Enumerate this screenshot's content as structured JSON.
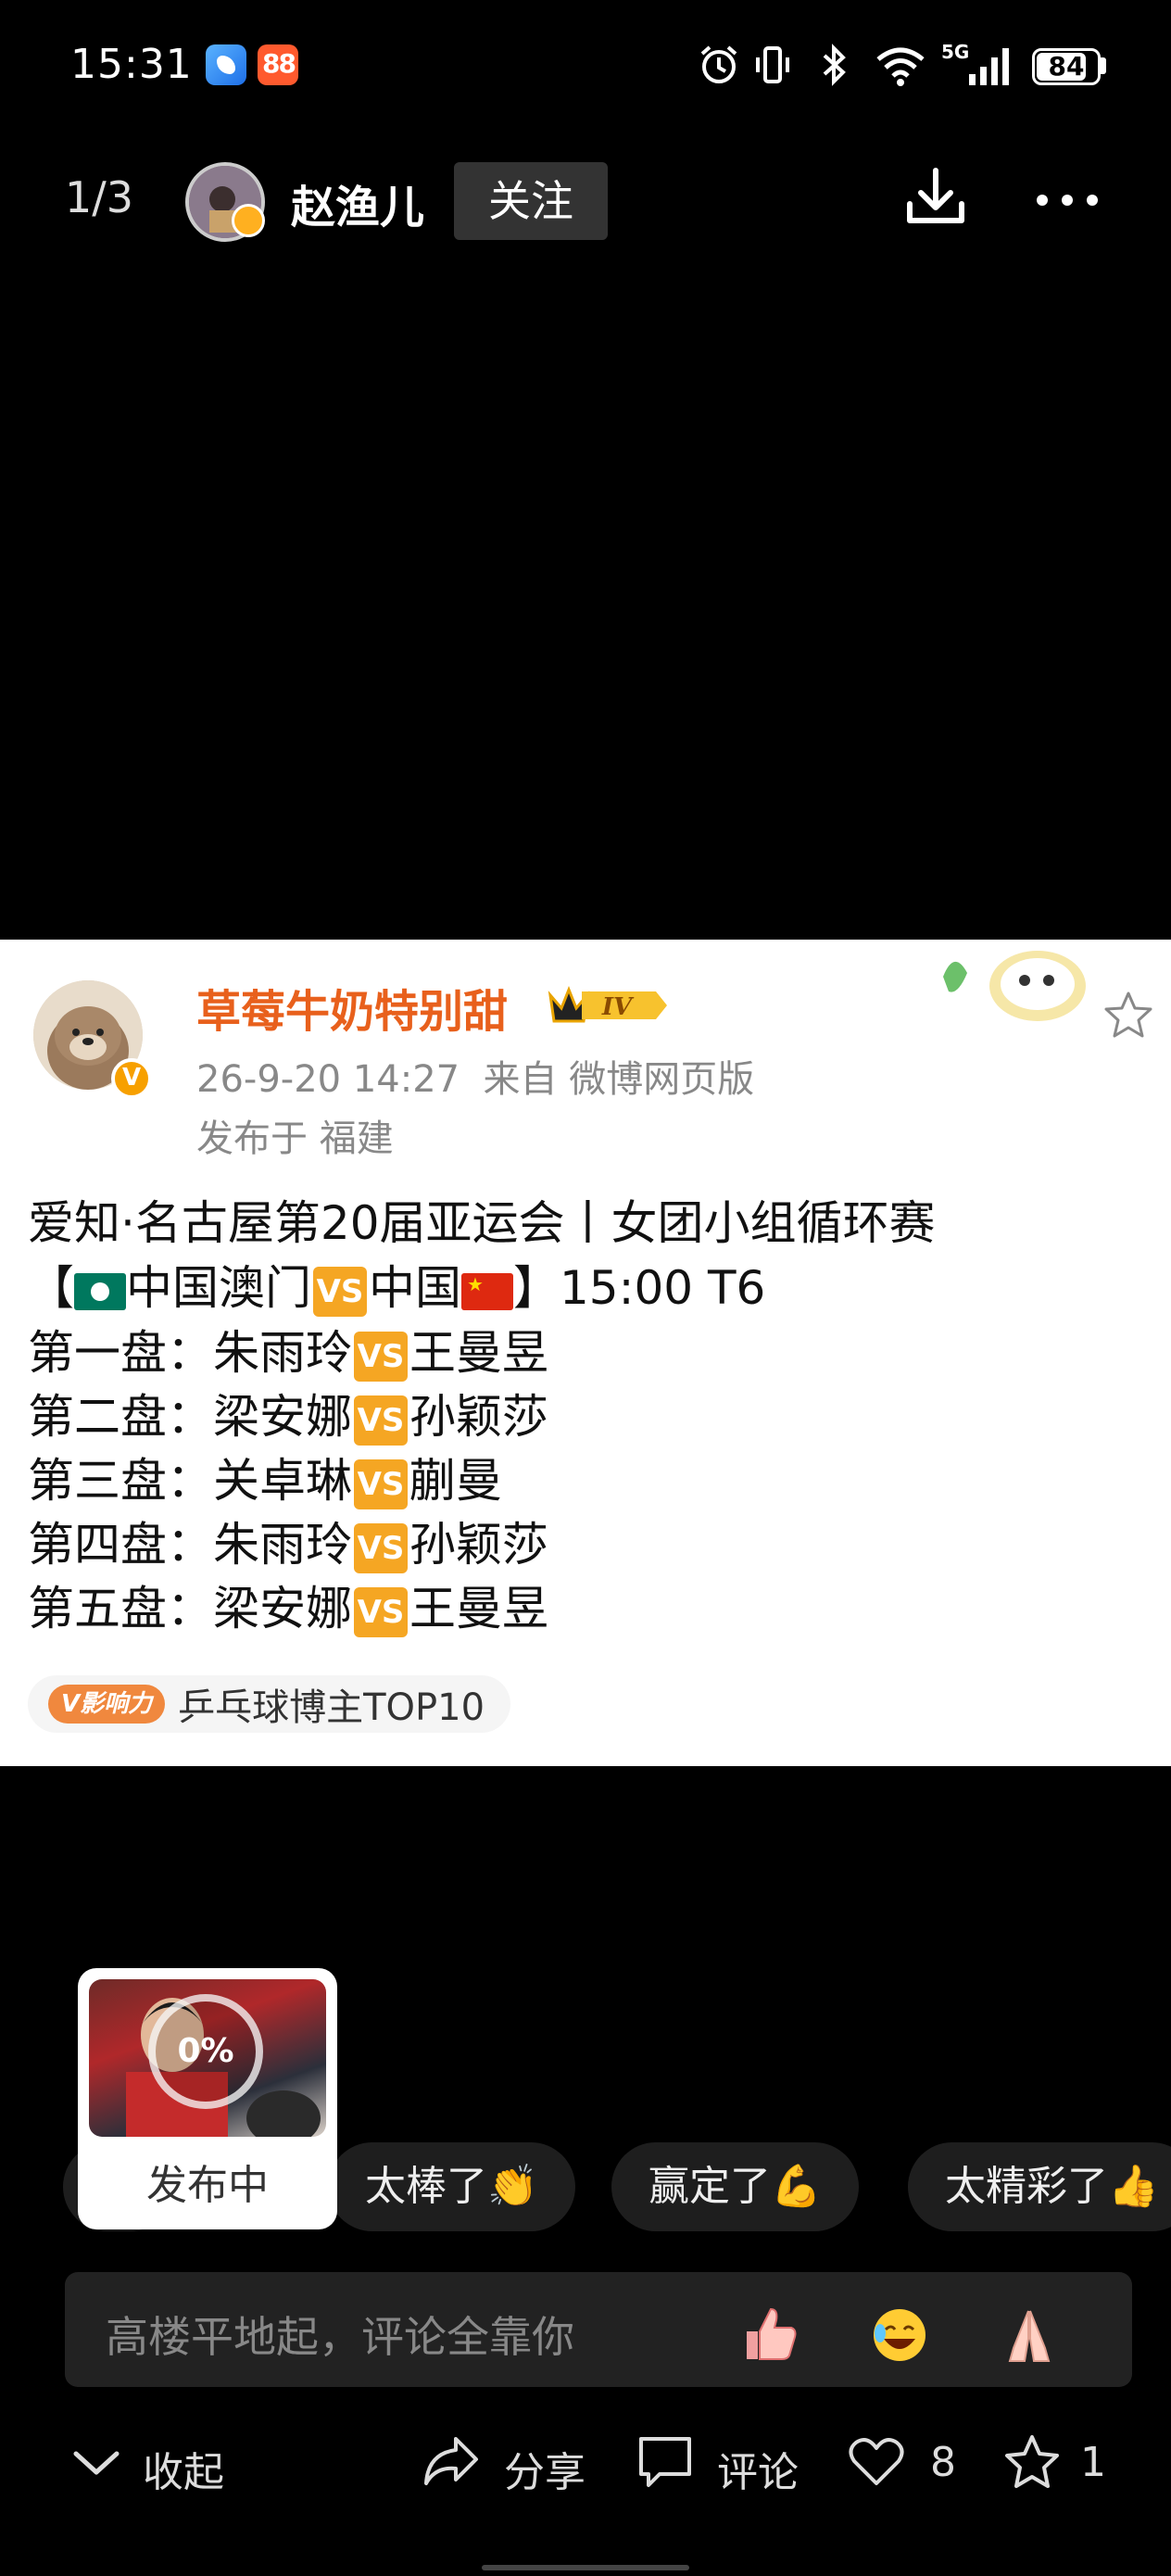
{
  "status_bar": {
    "time": "15:31",
    "network": "5G",
    "battery": "84",
    "battery_level": 0.84
  },
  "header": {
    "pager": "1/3",
    "username": "赵渔儿",
    "follow_label": "关注"
  },
  "post": {
    "author": "草莓牛奶特别甜",
    "level_badge": "IV",
    "time": "26-9-20 14:27",
    "source": "来自 微博网页版",
    "location": "发布于 福建",
    "vs_label": "VS",
    "lines": {
      "title": "爱知·名古屋第20届亚运会丨女团小组循环赛",
      "match_open": "【",
      "match_team1": "中国澳门",
      "match_team2": "中国",
      "match_close": "】15:00 T6",
      "g1_label": "第一盘：",
      "g1_p1": "朱雨玲",
      "g1_p2": "王曼昱",
      "g2_label": "第二盘：",
      "g2_p1": "梁安娜",
      "g2_p2": "孙颖莎",
      "g3_label": "第三盘：",
      "g3_p1": "关卓琳",
      "g3_p2": "蒯曼",
      "g4_label": "第四盘：",
      "g4_p1": "朱雨玲",
      "g4_p2": "孙颖莎",
      "g5_label": "第五盘：",
      "g5_p1": "梁安娜",
      "g5_p2": "王曼昱"
    },
    "influence_badge": "V影响力",
    "influence_text": "乒乓球博主TOP10"
  },
  "publishing": {
    "percent": "0%",
    "progress": 0,
    "label": "发布中"
  },
  "quick_replies": [
    "太棒了👏",
    "赢定了💪",
    "太精彩了👍"
  ],
  "comment": {
    "placeholder": "高楼平地起，评论全靠你"
  },
  "bottom_bar": {
    "collapse_label": "收起",
    "share_label": "分享",
    "comment_label": "评论",
    "like_count": "8",
    "favorite_count": "1"
  },
  "colors": {
    "accent": "#e8601c",
    "vs": "#f5a623",
    "background": "#000000",
    "card": "#ffffff"
  }
}
